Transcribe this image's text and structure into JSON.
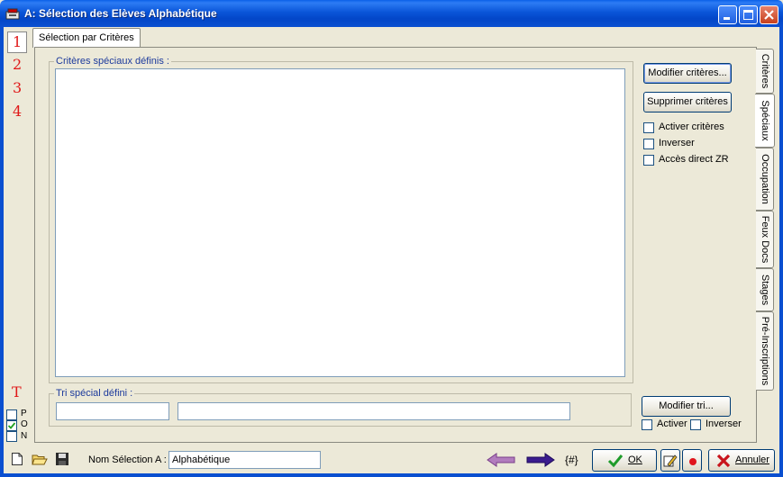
{
  "window": {
    "title": "A: Sélection des Elèves Alphabétique"
  },
  "left_numbers": [
    "1",
    "2",
    "3",
    "4"
  ],
  "left_letter": "T",
  "pon": [
    {
      "label": "P",
      "checked": false
    },
    {
      "label": "O",
      "checked": true
    },
    {
      "label": "N",
      "checked": false
    }
  ],
  "top_tab": {
    "label": "Sélection par Critères"
  },
  "criteria_group": {
    "label": "Critères spéciaux définis :"
  },
  "sort_group": {
    "label": "Tri spécial défini :"
  },
  "buttons": {
    "modify_criteria": "Modifier critères...",
    "delete_criteria": "Supprimer critères",
    "modify_sort": "Modifier tri...",
    "ok": "OK",
    "cancel": "Annuler"
  },
  "criteria_checks": [
    {
      "label": "Activer critères",
      "checked": false
    },
    {
      "label": "Inverser",
      "checked": false
    },
    {
      "label": "Accès direct ZR",
      "checked": false
    }
  ],
  "sort_checks": [
    {
      "label": "Activer",
      "checked": false
    },
    {
      "label": "Inverser",
      "checked": false
    }
  ],
  "vertical_tabs": [
    {
      "label": "Critères",
      "selected": false
    },
    {
      "label": "Spéciaux",
      "selected": true
    },
    {
      "label": "Occupation",
      "selected": false
    },
    {
      "label": "Feux Docs",
      "selected": false
    },
    {
      "label": "Stages",
      "selected": false
    },
    {
      "label": "Pré-Inscriptions",
      "selected": false
    }
  ],
  "bottom": {
    "selection_name_label": "Nom Sélection A :",
    "selection_name_value": "Alphabétique",
    "hash_label": "{#}"
  },
  "colors": {
    "title_bar": "#0A55D8",
    "number_red": "#E01818",
    "group_label_blue": "#1C3A9C",
    "arrow_back": "#9A5AA8",
    "arrow_forward": "#3A1C8E",
    "ok_check": "#1E9B2A",
    "cancel_x": "#C8141C"
  }
}
